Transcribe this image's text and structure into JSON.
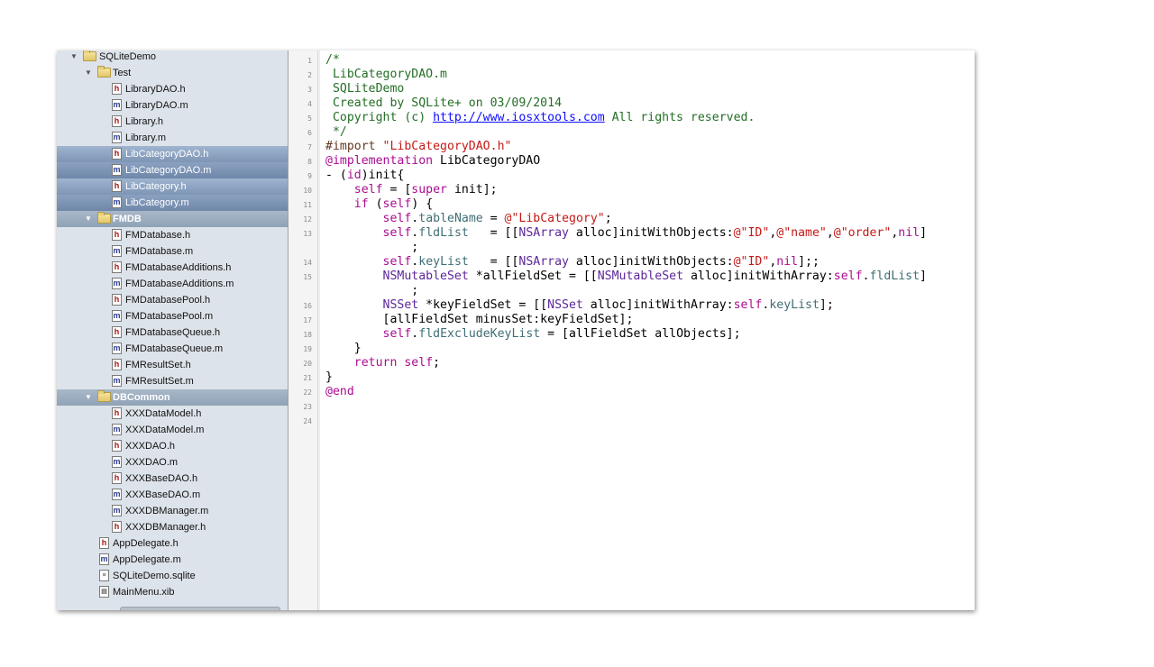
{
  "navigator": {
    "items": [
      {
        "label": "SQLiteDemo",
        "kind": "folder",
        "level": 0,
        "expanded": true,
        "style": "normal"
      },
      {
        "label": "Test",
        "kind": "folder",
        "level": 1,
        "expanded": true,
        "style": "normal"
      },
      {
        "label": "LibraryDAO.h",
        "kind": "h",
        "level": 2,
        "style": "normal"
      },
      {
        "label": "LibraryDAO.m",
        "kind": "m",
        "level": 2,
        "style": "normal"
      },
      {
        "label": "Library.h",
        "kind": "h",
        "level": 2,
        "style": "normal"
      },
      {
        "label": "Library.m",
        "kind": "m",
        "level": 2,
        "style": "normal"
      },
      {
        "label": "LibCategoryDAO.h",
        "kind": "h",
        "level": 2,
        "style": "selected"
      },
      {
        "label": "LibCategoryDAO.m",
        "kind": "m",
        "level": 2,
        "style": "selected"
      },
      {
        "label": "LibCategory.h",
        "kind": "h",
        "level": 2,
        "style": "selected"
      },
      {
        "label": "LibCategory.m",
        "kind": "m",
        "level": 2,
        "style": "selected"
      },
      {
        "label": "FMDB",
        "kind": "folder",
        "level": 1,
        "expanded": true,
        "style": "group"
      },
      {
        "label": "FMDatabase.h",
        "kind": "h",
        "level": 2,
        "style": "normal"
      },
      {
        "label": "FMDatabase.m",
        "kind": "m",
        "level": 2,
        "style": "normal"
      },
      {
        "label": "FMDatabaseAdditions.h",
        "kind": "h",
        "level": 2,
        "style": "normal"
      },
      {
        "label": "FMDatabaseAdditions.m",
        "kind": "m",
        "level": 2,
        "style": "normal"
      },
      {
        "label": "FMDatabasePool.h",
        "kind": "h",
        "level": 2,
        "style": "normal"
      },
      {
        "label": "FMDatabasePool.m",
        "kind": "m",
        "level": 2,
        "style": "normal"
      },
      {
        "label": "FMDatabaseQueue.h",
        "kind": "h",
        "level": 2,
        "style": "normal"
      },
      {
        "label": "FMDatabaseQueue.m",
        "kind": "m",
        "level": 2,
        "style": "normal"
      },
      {
        "label": "FMResultSet.h",
        "kind": "h",
        "level": 2,
        "style": "normal"
      },
      {
        "label": "FMResultSet.m",
        "kind": "m",
        "level": 2,
        "style": "normal"
      },
      {
        "label": "DBCommon",
        "kind": "folder",
        "level": 1,
        "expanded": true,
        "style": "group"
      },
      {
        "label": "XXXDataModel.h",
        "kind": "h",
        "level": 2,
        "style": "normal"
      },
      {
        "label": "XXXDataModel.m",
        "kind": "m",
        "level": 2,
        "style": "normal"
      },
      {
        "label": "XXXDAO.h",
        "kind": "h",
        "level": 2,
        "style": "normal"
      },
      {
        "label": "XXXDAO.m",
        "kind": "m",
        "level": 2,
        "style": "normal"
      },
      {
        "label": "XXXBaseDAO.h",
        "kind": "h",
        "level": 2,
        "style": "normal"
      },
      {
        "label": "XXXBaseDAO.m",
        "kind": "m",
        "level": 2,
        "style": "normal"
      },
      {
        "label": "XXXDBManager.m",
        "kind": "m",
        "level": 2,
        "style": "normal"
      },
      {
        "label": "XXXDBManager.h",
        "kind": "h",
        "level": 2,
        "style": "normal"
      },
      {
        "label": "AppDelegate.h",
        "kind": "h",
        "level": 1,
        "style": "normal"
      },
      {
        "label": "AppDelegate.m",
        "kind": "m",
        "level": 1,
        "style": "normal"
      },
      {
        "label": "SQLiteDemo.sqlite",
        "kind": "db",
        "level": 1,
        "style": "normal"
      },
      {
        "label": "MainMenu.xib",
        "kind": "xib",
        "level": 1,
        "style": "normal"
      }
    ]
  },
  "editor": {
    "line_numbers": [
      "1",
      "2",
      "3",
      "4",
      "5",
      "6",
      "7",
      "8",
      "9",
      "10",
      "11",
      "12",
      "13",
      "",
      "14",
      "15",
      "",
      "16",
      "17",
      "18",
      "19",
      "20",
      "21",
      "22",
      "23",
      "24"
    ],
    "lines": [
      [
        {
          "t": "/*",
          "c": "com"
        }
      ],
      [
        {
          "t": " LibCategoryDAO.m",
          "c": "com"
        }
      ],
      [
        {
          "t": " SQLiteDemo",
          "c": "com"
        }
      ],
      [
        {
          "t": " Created by SQLite+ on 03/09/2014",
          "c": "com"
        }
      ],
      [
        {
          "t": " Copyright (c) ",
          "c": "com"
        },
        {
          "t": "http://www.iosxtools.com",
          "c": "link"
        },
        {
          "t": " All rights reserved.",
          "c": "com"
        }
      ],
      [
        {
          "t": " */",
          "c": "com"
        }
      ],
      [
        {
          "t": "#import ",
          "c": "dir"
        },
        {
          "t": "\"LibCategoryDAO.h\"",
          "c": "str"
        }
      ],
      [
        {
          "t": "@implementation",
          "c": "kw"
        },
        {
          "t": " LibCategoryDAO",
          "c": ""
        }
      ],
      [
        {
          "t": "- (",
          "c": ""
        },
        {
          "t": "id",
          "c": "kw"
        },
        {
          "t": ")init{",
          "c": ""
        }
      ],
      [
        {
          "t": "    ",
          "c": ""
        },
        {
          "t": "self",
          "c": "kw"
        },
        {
          "t": " = [",
          "c": ""
        },
        {
          "t": "super",
          "c": "kw"
        },
        {
          "t": " init];",
          "c": ""
        }
      ],
      [
        {
          "t": "    ",
          "c": ""
        },
        {
          "t": "if",
          "c": "kw"
        },
        {
          "t": " (",
          "c": ""
        },
        {
          "t": "self",
          "c": "kw"
        },
        {
          "t": ") {",
          "c": ""
        }
      ],
      [
        {
          "t": "        ",
          "c": ""
        },
        {
          "t": "self",
          "c": "kw"
        },
        {
          "t": ".",
          "c": ""
        },
        {
          "t": "tableName",
          "c": "prop"
        },
        {
          "t": " = ",
          "c": ""
        },
        {
          "t": "@\"LibCategory\"",
          "c": "str"
        },
        {
          "t": ";",
          "c": ""
        }
      ],
      [
        {
          "t": "        ",
          "c": ""
        },
        {
          "t": "self",
          "c": "kw"
        },
        {
          "t": ".",
          "c": ""
        },
        {
          "t": "fldList",
          "c": "prop"
        },
        {
          "t": "   = [[",
          "c": ""
        },
        {
          "t": "NSArray",
          "c": "cls"
        },
        {
          "t": " alloc]initWithObjects:",
          "c": ""
        },
        {
          "t": "@\"ID\"",
          "c": "str"
        },
        {
          "t": ",",
          "c": ""
        },
        {
          "t": "@\"name\"",
          "c": "str"
        },
        {
          "t": ",",
          "c": ""
        },
        {
          "t": "@\"order\"",
          "c": "str"
        },
        {
          "t": ",",
          "c": ""
        },
        {
          "t": "nil",
          "c": "kw"
        },
        {
          "t": "]",
          "c": ""
        }
      ],
      [
        {
          "t": "            ;",
          "c": ""
        }
      ],
      [
        {
          "t": "        ",
          "c": ""
        },
        {
          "t": "self",
          "c": "kw"
        },
        {
          "t": ".",
          "c": ""
        },
        {
          "t": "keyList",
          "c": "prop"
        },
        {
          "t": "   = [[",
          "c": ""
        },
        {
          "t": "NSArray",
          "c": "cls"
        },
        {
          "t": " alloc]initWithObjects:",
          "c": ""
        },
        {
          "t": "@\"ID\"",
          "c": "str"
        },
        {
          "t": ",",
          "c": ""
        },
        {
          "t": "nil",
          "c": "kw"
        },
        {
          "t": "];;",
          "c": ""
        }
      ],
      [
        {
          "t": "        ",
          "c": ""
        },
        {
          "t": "NSMutableSet",
          "c": "cls"
        },
        {
          "t": " *allFieldSet = [[",
          "c": ""
        },
        {
          "t": "NSMutableSet",
          "c": "cls"
        },
        {
          "t": " alloc]initWithArray:",
          "c": ""
        },
        {
          "t": "self",
          "c": "kw"
        },
        {
          "t": ".",
          "c": ""
        },
        {
          "t": "fldList",
          "c": "prop"
        },
        {
          "t": "]",
          "c": ""
        }
      ],
      [
        {
          "t": "            ;",
          "c": ""
        }
      ],
      [
        {
          "t": "        ",
          "c": ""
        },
        {
          "t": "NSSet",
          "c": "cls"
        },
        {
          "t": " *keyFieldSet = [[",
          "c": ""
        },
        {
          "t": "NSSet",
          "c": "cls"
        },
        {
          "t": " alloc]initWithArray:",
          "c": ""
        },
        {
          "t": "self",
          "c": "kw"
        },
        {
          "t": ".",
          "c": ""
        },
        {
          "t": "keyList",
          "c": "prop"
        },
        {
          "t": "];",
          "c": ""
        }
      ],
      [
        {
          "t": "        [allFieldSet minusSet:keyFieldSet];",
          "c": ""
        }
      ],
      [
        {
          "t": "        ",
          "c": ""
        },
        {
          "t": "self",
          "c": "kw"
        },
        {
          "t": ".",
          "c": ""
        },
        {
          "t": "fldExcludeKeyList",
          "c": "prop"
        },
        {
          "t": " = [allFieldSet allObjects];",
          "c": ""
        }
      ],
      [
        {
          "t": "    }",
          "c": ""
        }
      ],
      [
        {
          "t": "    ",
          "c": ""
        },
        {
          "t": "return",
          "c": "kw"
        },
        {
          "t": " ",
          "c": ""
        },
        {
          "t": "self",
          "c": "kw"
        },
        {
          "t": ";",
          "c": ""
        }
      ],
      [
        {
          "t": "}",
          "c": ""
        }
      ],
      [
        {
          "t": "@end",
          "c": "kw"
        }
      ],
      [],
      []
    ]
  }
}
